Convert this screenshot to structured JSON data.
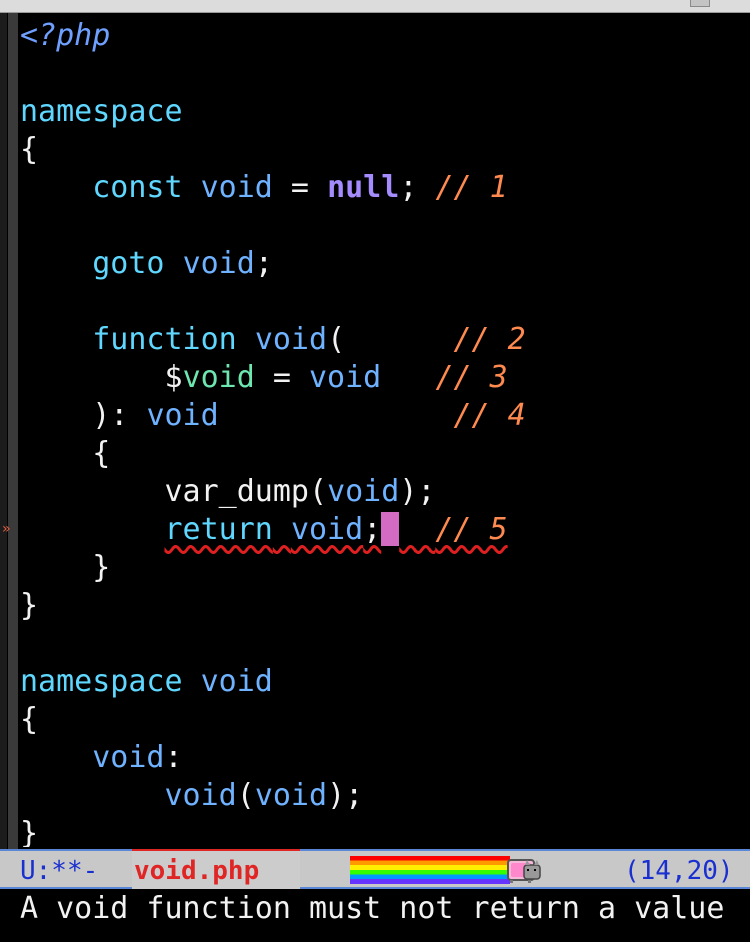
{
  "editor": {
    "buffer_lines": [
      [
        {
          "t": "<?php",
          "c": "php"
        }
      ],
      [],
      [
        {
          "t": "namespace",
          "c": "kw"
        }
      ],
      [
        {
          "t": "{",
          "c": "plain"
        }
      ],
      [
        {
          "t": "    ",
          "c": "plain"
        },
        {
          "t": "const",
          "c": "kw"
        },
        {
          "t": " ",
          "c": "plain"
        },
        {
          "t": "void",
          "c": "fn"
        },
        {
          "t": " = ",
          "c": "plain"
        },
        {
          "t": "null",
          "c": "const"
        },
        {
          "t": "; ",
          "c": "plain"
        },
        {
          "t": "// 1",
          "c": "cmt"
        }
      ],
      [],
      [
        {
          "t": "    ",
          "c": "plain"
        },
        {
          "t": "goto",
          "c": "kw"
        },
        {
          "t": " ",
          "c": "plain"
        },
        {
          "t": "void",
          "c": "fn"
        },
        {
          "t": ";",
          "c": "plain"
        }
      ],
      [],
      [
        {
          "t": "    ",
          "c": "plain"
        },
        {
          "t": "function",
          "c": "kw"
        },
        {
          "t": " ",
          "c": "plain"
        },
        {
          "t": "void",
          "c": "fn"
        },
        {
          "t": "(      ",
          "c": "plain"
        },
        {
          "t": "// 2",
          "c": "cmt"
        }
      ],
      [
        {
          "t": "        ",
          "c": "plain"
        },
        {
          "t": "$",
          "c": "plain"
        },
        {
          "t": "void",
          "c": "var"
        },
        {
          "t": " = ",
          "c": "plain"
        },
        {
          "t": "void",
          "c": "fn"
        },
        {
          "t": "   ",
          "c": "plain"
        },
        {
          "t": "// 3",
          "c": "cmt"
        }
      ],
      [
        {
          "t": "    ",
          "c": "plain"
        },
        {
          "t": "): ",
          "c": "plain"
        },
        {
          "t": "void",
          "c": "fn"
        },
        {
          "t": "             ",
          "c": "plain"
        },
        {
          "t": "// 4",
          "c": "cmt"
        }
      ],
      [
        {
          "t": "    ",
          "c": "plain"
        },
        {
          "t": "{",
          "c": "plain"
        }
      ],
      [
        {
          "t": "        ",
          "c": "plain"
        },
        {
          "t": "var_dump(",
          "c": "plain"
        },
        {
          "t": "void",
          "c": "fn"
        },
        {
          "t": ");",
          "c": "plain"
        }
      ],
      [
        {
          "t": "        ",
          "c": "plain"
        },
        {
          "t": "return",
          "c": "kw",
          "err": true
        },
        {
          "t": " ",
          "c": "plain",
          "err": true
        },
        {
          "t": "void",
          "c": "fn",
          "err": true
        },
        {
          "t": ";",
          "c": "plain",
          "err": true
        },
        {
          "t": "",
          "c": "cursor"
        },
        {
          "t": "  ",
          "c": "plain",
          "err": true
        },
        {
          "t": "// 5",
          "c": "cmt",
          "err": true
        }
      ],
      [
        {
          "t": "    ",
          "c": "plain"
        },
        {
          "t": "}",
          "c": "plain"
        }
      ],
      [
        {
          "t": "}",
          "c": "plain"
        }
      ],
      [],
      [
        {
          "t": "namespace",
          "c": "kw"
        },
        {
          "t": " ",
          "c": "plain"
        },
        {
          "t": "void",
          "c": "fn"
        }
      ],
      [
        {
          "t": "{",
          "c": "plain"
        }
      ],
      [
        {
          "t": "    ",
          "c": "plain"
        },
        {
          "t": "void",
          "c": "fn"
        },
        {
          "t": ":",
          "c": "plain"
        }
      ],
      [
        {
          "t": "        ",
          "c": "plain"
        },
        {
          "t": "void",
          "c": "fn"
        },
        {
          "t": "(",
          "c": "plain"
        },
        {
          "t": "void",
          "c": "fn"
        },
        {
          "t": ");",
          "c": "plain"
        }
      ],
      [
        {
          "t": "}",
          "c": "plain"
        }
      ]
    ],
    "fringe_marker": "»"
  },
  "modeline": {
    "status": "U:**-",
    "buffer_name": "void.php",
    "position": "(14,20)"
  },
  "minibuffer": {
    "message": "A void function must not return a value"
  },
  "colors": {
    "keyword": "#5fd7ff",
    "identifier": "#6fb2ff",
    "variable": "#6ee6b0",
    "constant": "#a48cff",
    "comment": "#ff8a50",
    "cursor": "#d46bc2",
    "error_underline": "#e02020",
    "buffer_name": "#e02525",
    "modeline_text": "#1a2fd0"
  },
  "icons": {
    "mode_indicator": "nyan-cat-icon"
  }
}
